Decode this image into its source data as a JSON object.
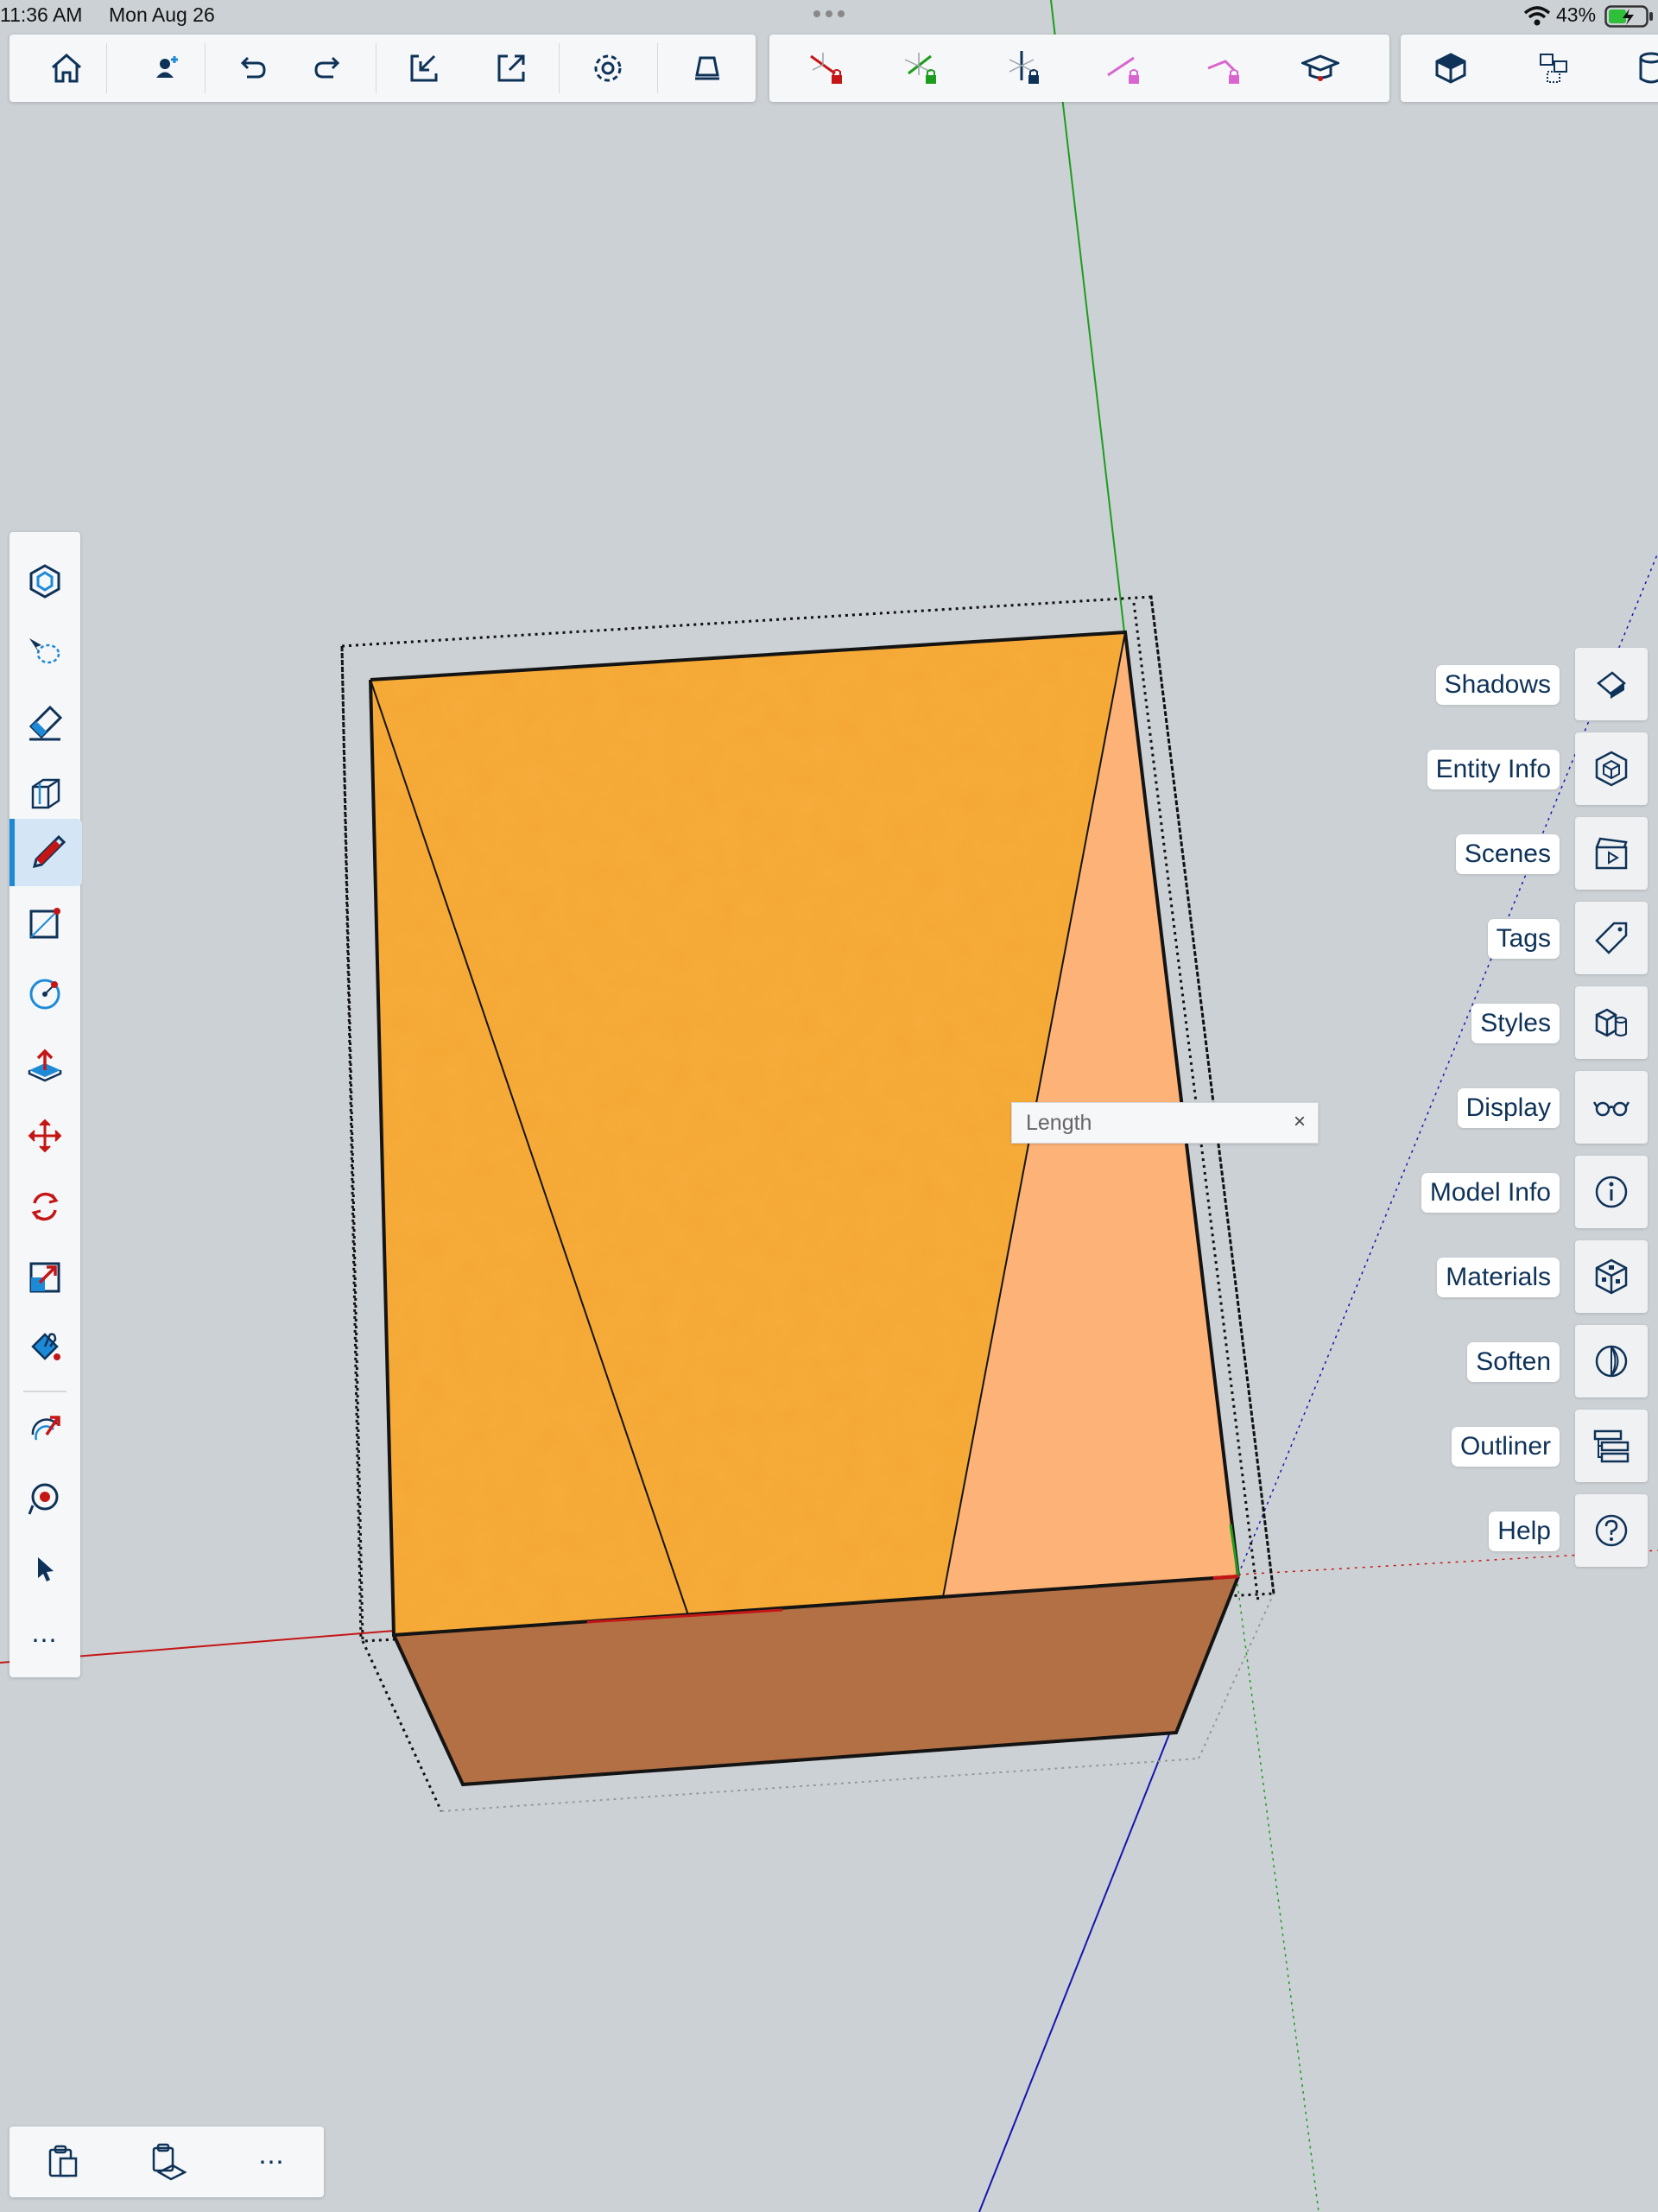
{
  "status_bar": {
    "time": "11:36 AM",
    "date": "Mon Aug 26",
    "battery": "43%"
  },
  "top_toolbar": {
    "file_group": [
      "home-icon",
      "add-user-icon",
      "undo-icon",
      "redo-icon",
      "import-icon",
      "export-icon",
      "settings-icon",
      "view-icon"
    ],
    "axis_group": [
      "red-axis-lock-icon",
      "green-axis-lock-icon",
      "blue-axis-lock-icon",
      "magenta-axis-lock-icon",
      "pink-axis-lock-icon",
      "instructor-icon"
    ],
    "view_group": [
      "iso-view-icon",
      "components-icon",
      "cylinder-icon"
    ]
  },
  "left_toolbar": {
    "tools": [
      "components-tool-icon",
      "lasso-select-icon",
      "eraser-icon",
      "section-box-icon",
      "pencil-icon",
      "rectangle-icon",
      "circle-icon",
      "push-pull-icon",
      "move-icon",
      "rotate-icon",
      "scale-icon",
      "paint-bucket-icon",
      "follow-me-icon",
      "tape-measure-icon",
      "select-icon"
    ],
    "more": "⋯",
    "active_tool": "pencil-icon"
  },
  "panels": [
    {
      "label": "Shadows",
      "icon": "shadows-icon"
    },
    {
      "label": "Entity Info",
      "icon": "entity-info-icon"
    },
    {
      "label": "Scenes",
      "icon": "scenes-icon"
    },
    {
      "label": "Tags",
      "icon": "tags-icon"
    },
    {
      "label": "Styles",
      "icon": "styles-icon"
    },
    {
      "label": "Display",
      "icon": "display-icon"
    },
    {
      "label": "Model Info",
      "icon": "model-info-icon"
    },
    {
      "label": "Materials",
      "icon": "materials-icon"
    },
    {
      "label": "Soften",
      "icon": "soften-icon"
    },
    {
      "label": "Outliner",
      "icon": "outliner-icon"
    },
    {
      "label": "Help",
      "icon": "help-icon"
    }
  ],
  "length_field": {
    "placeholder": "Length",
    "close": "×"
  },
  "bottom_toolbar": {
    "more": "⋯"
  },
  "colors": {
    "top_face": "#f5a734",
    "right_face": "#fdb377",
    "front_face": "#b27044",
    "red_axis": "#c51616",
    "green_axis": "#1d9d1d",
    "blue_axis": "#1515b0",
    "accent": "#1d8ad7",
    "background": "#ccd1d5"
  }
}
